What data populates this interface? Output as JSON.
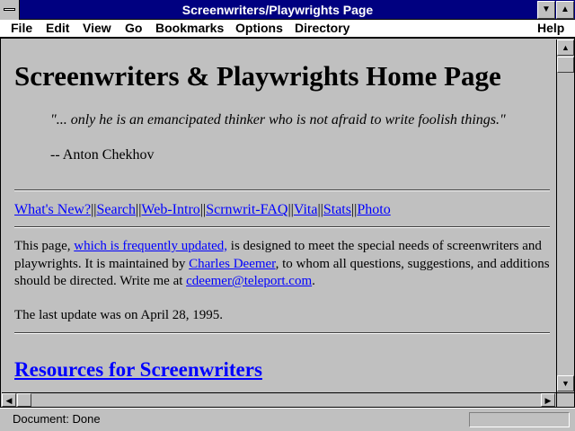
{
  "window": {
    "title": "Screenwriters/Playwrights Page"
  },
  "menu": {
    "file": "File",
    "edit": "Edit",
    "view": "View",
    "go": "Go",
    "bookmarks": "Bookmarks",
    "options": "Options",
    "directory": "Directory",
    "help": "Help"
  },
  "page": {
    "heading": "Screenwriters & Playwrights Home Page",
    "quote": "\"... only he is an emancipated thinker who is not afraid to write foolish things.\"",
    "attribution": "-- Anton Chekhov",
    "nav": {
      "whats_new": "What's New?",
      "search": "Search",
      "web_intro": "Web-Intro",
      "scrnwrit_faq": "Scrnwrit-FAQ",
      "vita": "Vita",
      "stats": "Stats",
      "photo": "Photo",
      "separator": "||"
    },
    "intro": {
      "t1": "This page, ",
      "link_updated": "which is frequently updated,",
      "t2": " is designed to meet the special needs of screenwriters and",
      "t3": "playwrights. It is maintained by ",
      "link_author": "Charles Deemer",
      "t4": ", to whom all questions, suggestions, and additions",
      "t5": "should be directed. Write me at ",
      "link_email": "cdeemer@teleport.com",
      "t6": "."
    },
    "last_update": "The last update was on April 28, 1995.",
    "section_heading": "Resources for Screenwriters"
  },
  "status": {
    "text": "Document: Done"
  },
  "icons": {
    "system_menu": "system-menu-icon",
    "minimize": "minimize-icon",
    "maximize": "maximize-icon",
    "scroll_up": "up-arrow-icon",
    "scroll_down": "down-arrow-icon",
    "scroll_left": "left-arrow-icon",
    "scroll_right": "right-arrow-icon"
  },
  "colors": {
    "titlebar": "#000080",
    "link": "#0000ff",
    "background": "#c0c0c0"
  }
}
